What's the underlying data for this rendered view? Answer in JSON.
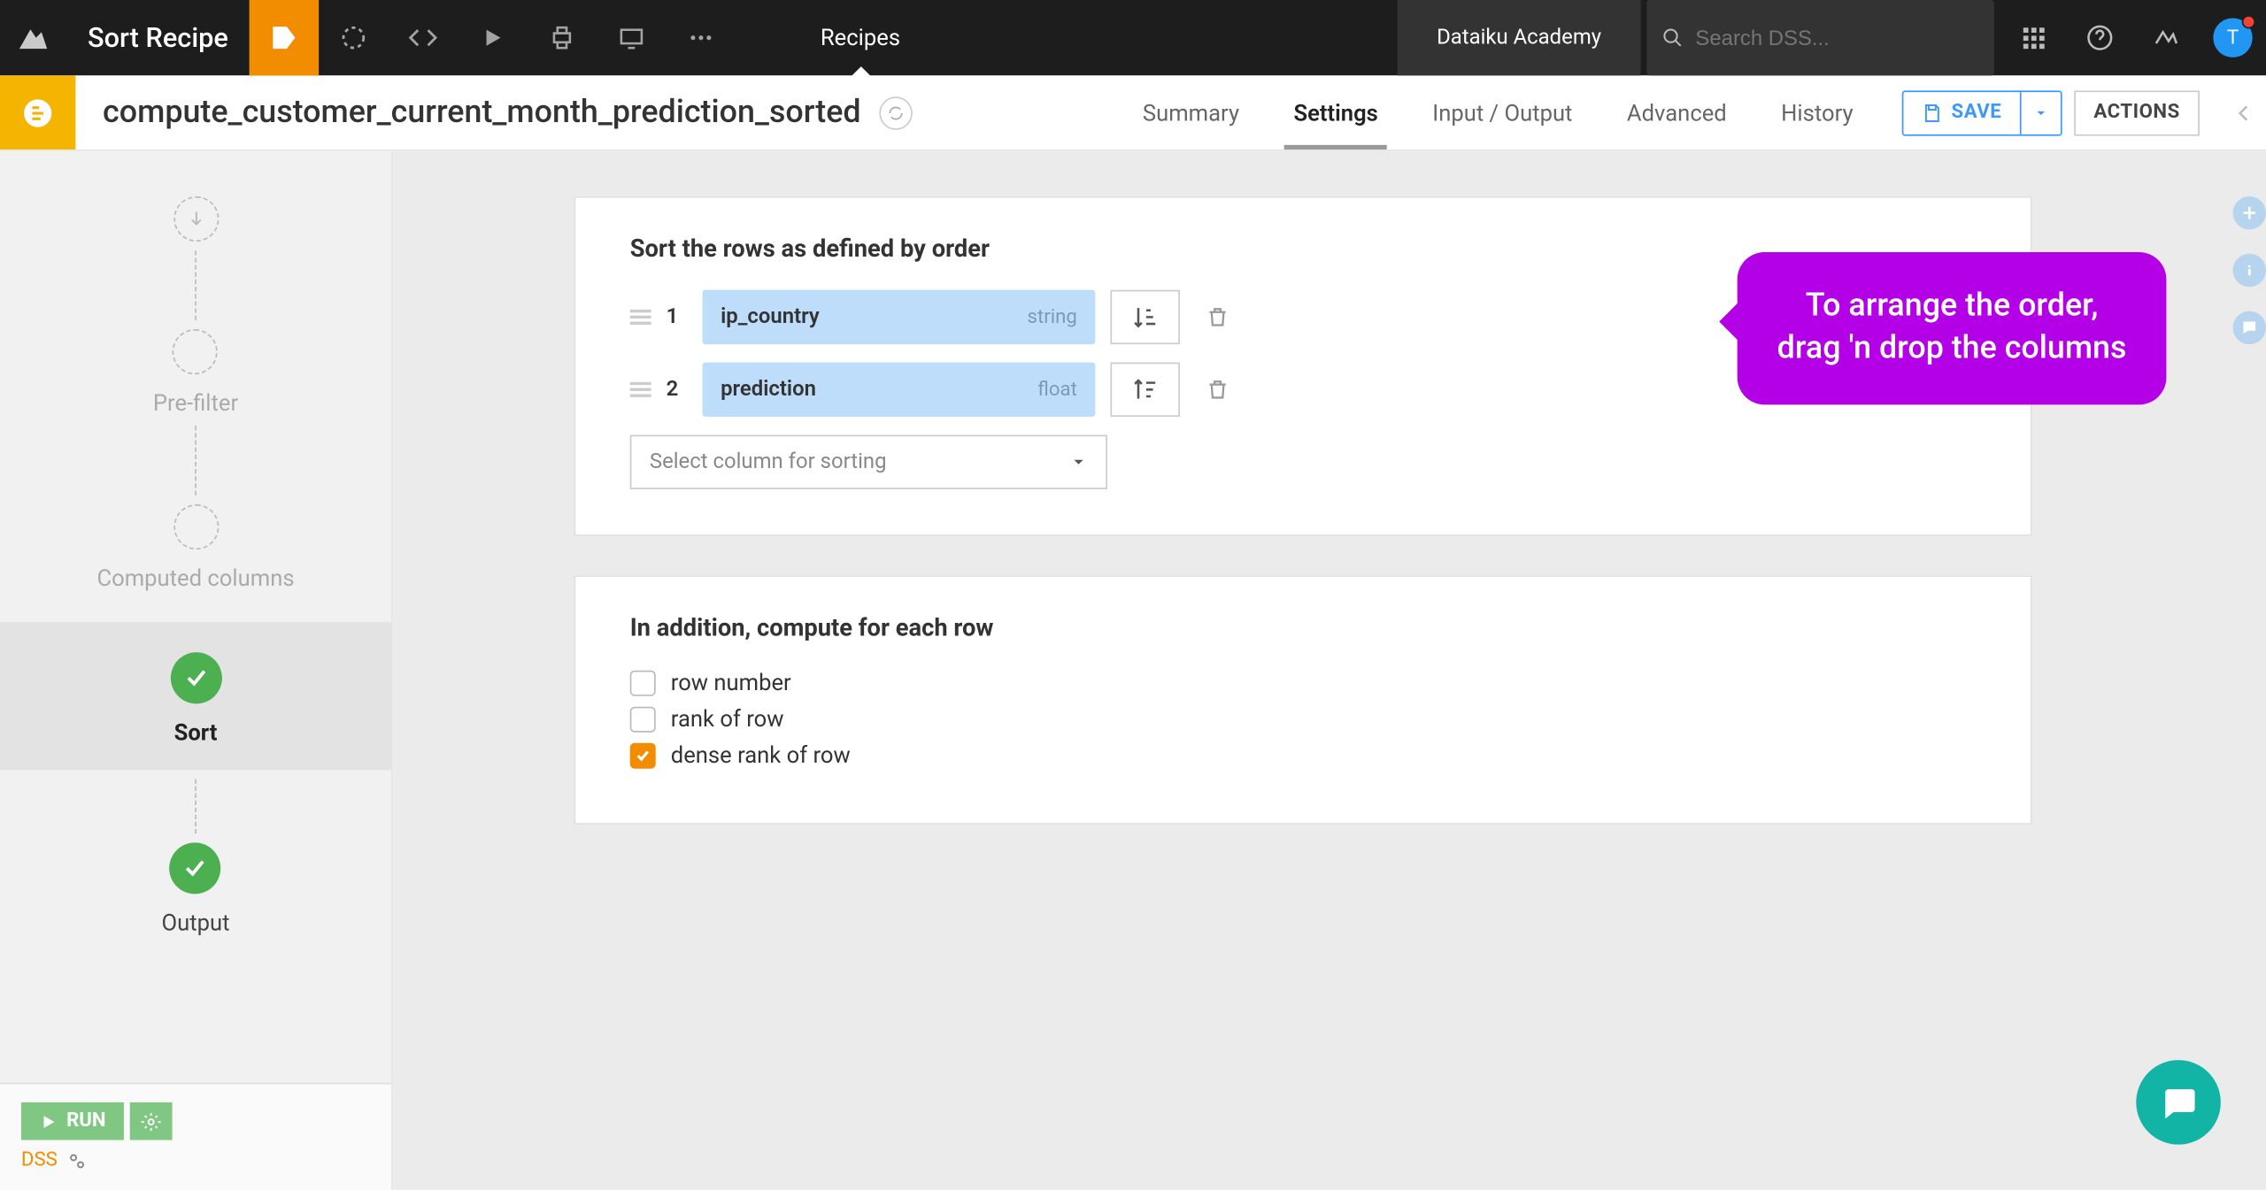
{
  "topbar": {
    "title": "Sort Recipe",
    "menu_recipes": "Recipes",
    "academy": "Dataiku Academy",
    "search_placeholder": "Search DSS...",
    "avatar_letter": "T"
  },
  "subheader": {
    "recipe_name": "compute_customer_current_month_prediction_sorted",
    "tabs": {
      "summary": "Summary",
      "settings": "Settings",
      "io": "Input / Output",
      "advanced": "Advanced",
      "history": "History"
    },
    "save": "SAVE",
    "actions": "ACTIONS"
  },
  "steps": {
    "prefilter": "Pre-filter",
    "computed": "Computed columns",
    "sort": "Sort",
    "output": "Output"
  },
  "footer": {
    "run": "RUN",
    "engine": "DSS"
  },
  "panel_sort": {
    "heading": "Sort the rows as defined by order",
    "rows": [
      {
        "idx": "1",
        "column": "ip_country",
        "type": "string"
      },
      {
        "idx": "2",
        "column": "prediction",
        "type": "float"
      }
    ],
    "select_placeholder": "Select column for sorting"
  },
  "panel_compute": {
    "heading": "In addition, compute for each row",
    "options": [
      {
        "label": "row number",
        "checked": false
      },
      {
        "label": "rank of row",
        "checked": false
      },
      {
        "label": "dense rank of row",
        "checked": true
      }
    ]
  },
  "callout": "To arrange the order, drag 'n drop the columns"
}
